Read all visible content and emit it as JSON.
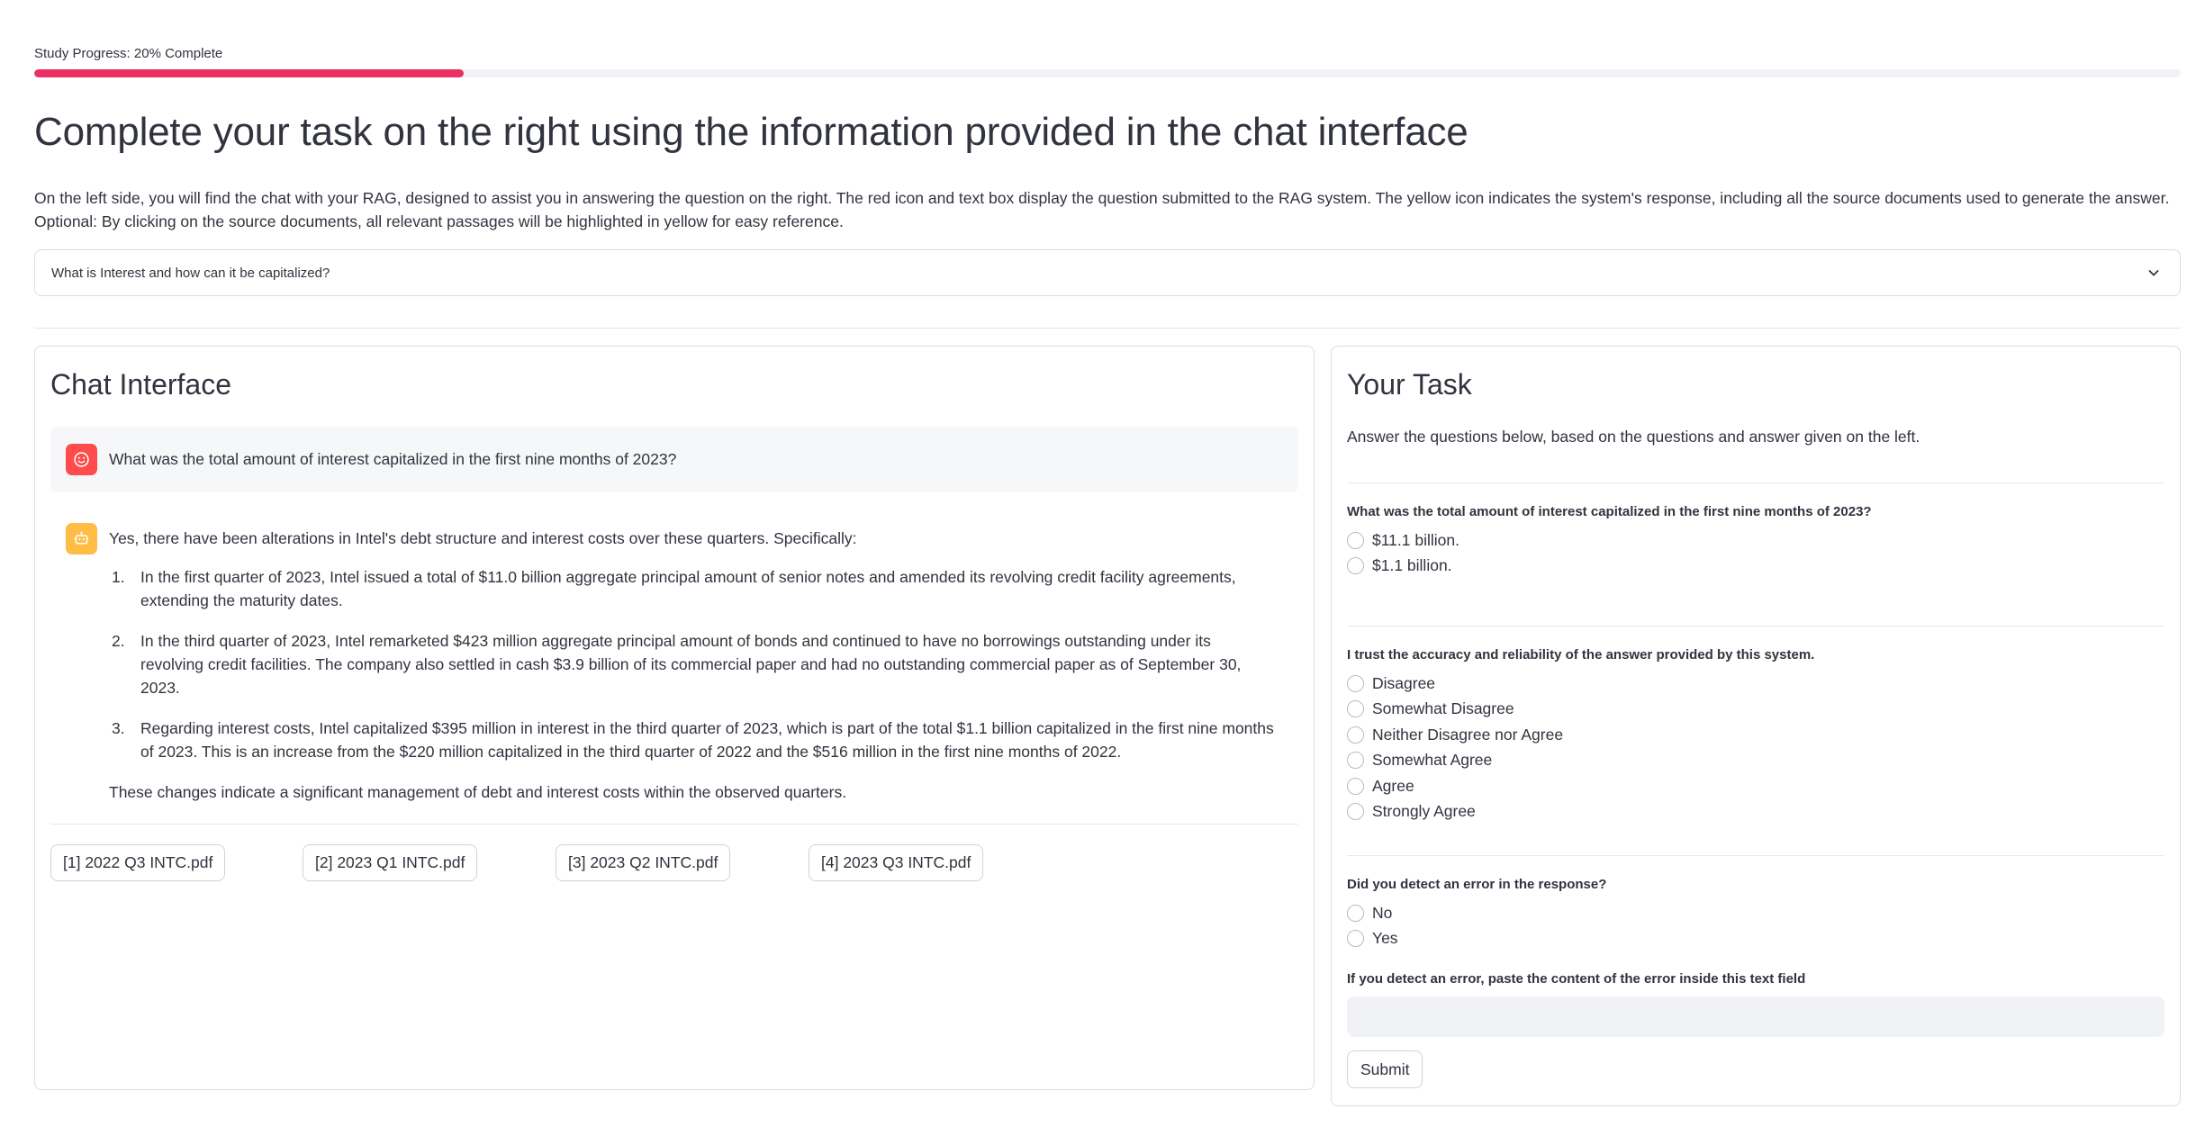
{
  "progress": {
    "label": "Study Progress: 20% Complete",
    "fraction": 0.2,
    "color": "#ec2f63"
  },
  "page": {
    "title": "Complete your task on the right using the information provided in the chat interface",
    "intro": "On the left side, you will find the chat with your RAG, designed to assist you in answering the question on the right. The red icon and text box display the question submitted to the RAG system. The yellow icon indicates the system's response, including all the source documents used to generate the answer. Optional: By clicking on the source documents, all relevant passages will be highlighted in yellow for easy reference.",
    "expander_label": "What is Interest and how can it be capitalized?",
    "expander_icon": "chevron-down-icon"
  },
  "chat": {
    "title": "Chat Interface",
    "user_icon": "smiley-face-icon",
    "bot_icon": "robot-face-icon",
    "user_color": "#ff4b4b",
    "bot_color": "#ffbd45",
    "user_message": "What was the total amount of interest capitalized in the first nine months of 2023?",
    "bot_intro": "Yes, there have been alterations in Intel's debt structure and interest costs over these quarters. Specifically:",
    "bot_items": [
      {
        "num": "1.",
        "text": "In the first quarter of 2023, Intel issued a total of $11.0 billion aggregate principal amount of senior notes and amended its revolving credit facility agreements, extending the maturity dates."
      },
      {
        "num": "2.",
        "text": "In the third quarter of 2023, Intel remarketed $423 million aggregate principal amount of bonds and continued to have no borrowings outstanding under its revolving credit facilities. The company also settled in cash $3.9 billion of its commercial paper and had no outstanding commercial paper as of September 30, 2023."
      },
      {
        "num": "3.",
        "text": "Regarding interest costs, Intel capitalized $395 million in interest in the third quarter of 2023, which is part of the total $1.1 billion capitalized in the first nine months of 2023. This is an increase from the $220 million capitalized in the third quarter of 2022 and the $516 million in the first nine months of 2022."
      }
    ],
    "bot_outro": "These changes indicate a significant management of debt and interest costs within the observed quarters.",
    "sources": [
      "[1] 2022 Q3 INTC.pdf",
      "[2] 2023 Q1 INTC.pdf",
      "[3] 2023 Q2 INTC.pdf",
      "[4] 2023 Q3 INTC.pdf"
    ]
  },
  "task": {
    "title": "Your Task",
    "subtitle": "Answer the questions below, based on the questions and answer given on the left.",
    "q1": {
      "label": "What was the total amount of interest capitalized in the first nine months of 2023?",
      "options": [
        "$11.1 billion.",
        "$1.1 billion."
      ]
    },
    "q2": {
      "label": "I trust the accuracy and reliability of the answer provided by this system.",
      "options": [
        "Disagree",
        "Somewhat Disagree",
        "Neither Disagree nor Agree",
        "Somewhat Agree",
        "Agree",
        "Strongly Agree"
      ]
    },
    "q3": {
      "label": "Did you detect an error in the response?",
      "options": [
        "No",
        "Yes"
      ]
    },
    "error_field": {
      "label": "If you detect an error, paste the content of the error inside this text field",
      "value": "",
      "placeholder": ""
    },
    "submit_label": "Submit"
  }
}
